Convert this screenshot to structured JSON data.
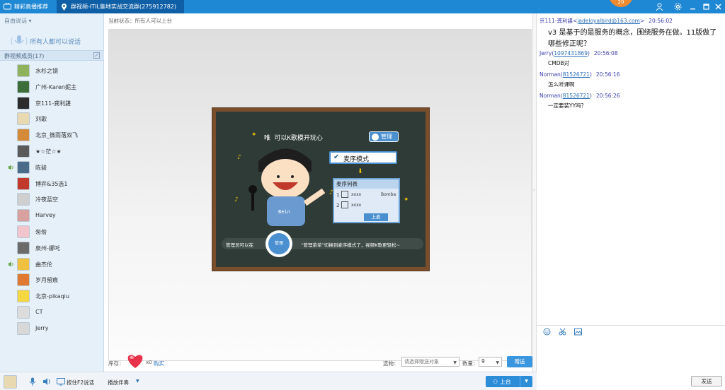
{
  "titlebar": {
    "tab1_label": "精彩直播推荐",
    "tab2_label": "群视频-ITIL集地实战交流群(275912782)",
    "badge": "20"
  },
  "left": {
    "mode_select": "自由说话",
    "all_speak": "所有人都可以说话",
    "members_header": "群视频成员(17)",
    "members": [
      {
        "name": "水杉之镜",
        "speaking": false,
        "color": "#8fb35a"
      },
      {
        "name": "广州-Karen妮主",
        "speaking": false,
        "color": "#3d6e3a"
      },
      {
        "name": "京111-龚利諶",
        "speaking": false,
        "color": "#2c2c2c"
      },
      {
        "name": "刘歌",
        "speaking": false,
        "color": "#e8d9b0"
      },
      {
        "name": "北京_微雨落双飞",
        "speaking": false,
        "color": "#d58a3a"
      },
      {
        "name": "★☆茫☆★",
        "speaking": false,
        "color": "#5a5a5a"
      },
      {
        "name": "陈骏",
        "speaking": true,
        "color": "#4a6b8a"
      },
      {
        "name": "博弈&35选1",
        "speaking": false,
        "color": "#c0392b"
      },
      {
        "name": "冷夜蓝空",
        "speaking": false,
        "color": "#cfcfcf"
      },
      {
        "name": "Harvey",
        "speaking": false,
        "color": "#d9a0a0"
      },
      {
        "name": "匆匆",
        "speaking": false,
        "color": "#f2c4cc"
      },
      {
        "name": "泉州-娜吒",
        "speaking": false,
        "color": "#6b6b6b"
      },
      {
        "name": "曲杰伦",
        "speaking": true,
        "color": "#f0c040"
      },
      {
        "name": "岁月留痕",
        "speaking": false,
        "color": "#e07a30"
      },
      {
        "name": "北京-pikaqiu",
        "speaking": false,
        "color": "#f5d742"
      },
      {
        "name": "CT",
        "speaking": false,
        "color": "#dcdcdc"
      },
      {
        "name": "Jerry",
        "speaking": false,
        "color": "#d8d8d8"
      }
    ]
  },
  "center": {
    "status": "当前状态：所有人可以上台",
    "board": {
      "headline": "唯 可以K歌模开玩心",
      "manage_tag": "管理",
      "queue_mode": "麦序模式",
      "queue_list": "麦序列表",
      "row1_num": "1",
      "row1_name": "xxxx",
      "row1_song": "Bomba",
      "row2_num": "2",
      "row2_name": "xxxx",
      "up_btn": "上麦",
      "shirt": "Bein",
      "bar_left": "管理员可以在",
      "bar_circle": "管理",
      "bar_right": "“管理菜单”切换到麦序模式了，视频K歌更轻松~"
    },
    "stock_label": "库存：",
    "heart_count": "x0",
    "buy": "购买",
    "gift_label": "选物：",
    "gift_placeholder": "请选择赠送对象",
    "qty_label": "数量：",
    "qty_value": "9",
    "send_gift": "赠送"
  },
  "chat": {
    "messages": [
      {
        "sender": "京111-龚利諶",
        "contact": "jadeloyalbird@163.com",
        "open": "<",
        "close": ">",
        "time": "20:56:02",
        "body": [
          "v3 是基于的是服务的概念，围绕服务在做。11版做了",
          "哪些修正呢？"
        ]
      },
      {
        "sender": "Jerry",
        "contact": "1097431869",
        "open": "(",
        "close": ")",
        "time": "20:56:08",
        "body": [
          "CMDB对"
        ]
      },
      {
        "sender": "Norman",
        "contact": "81526721",
        "open": "(",
        "close": ")",
        "time": "20:56:16",
        "body": [
          "怎么听课啊"
        ]
      },
      {
        "sender": "Norman",
        "contact": "81526721",
        "open": "(",
        "close": ")",
        "time": "20:56:26",
        "body": [
          "一定要装YY吗？"
        ]
      }
    ],
    "send": "发送"
  },
  "bottom": {
    "ptt": "按住F2说话",
    "music": "播放伴奏",
    "onstage": "上台"
  },
  "colors": {
    "accent": "#1f88d4",
    "link": "#2a6fb7"
  }
}
